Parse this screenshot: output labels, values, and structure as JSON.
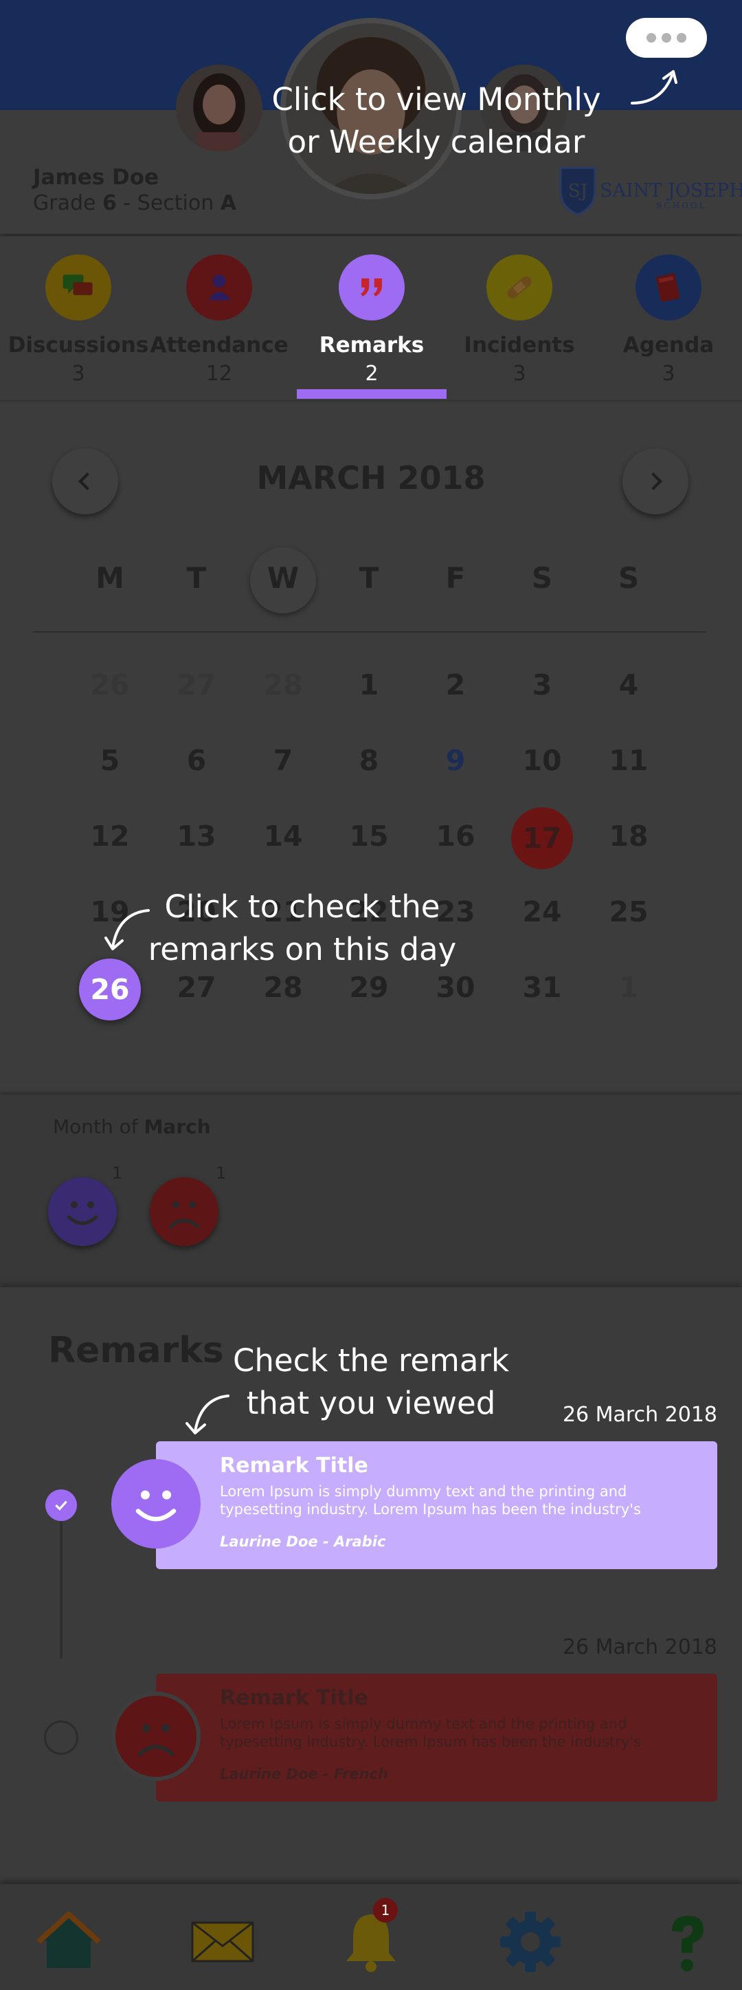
{
  "header": {
    "student_name": "James Doe",
    "grade_prefix": "Grade ",
    "grade_number": "6",
    "section_prefix": " - Section ",
    "section_letter": "A",
    "school_name": "SAINT JOSEPH",
    "school_sub": "SCHOOL",
    "school_monogram": "SJ"
  },
  "tabs": [
    {
      "label": "Discussions",
      "count": "3",
      "icon": "chat-bubbles-icon",
      "color": "#6b5608"
    },
    {
      "label": "Attendance",
      "count": "12",
      "icon": "person-icon",
      "color": "#5f1515"
    },
    {
      "label": "Remarks",
      "count": "2",
      "icon": "quote-icon",
      "color": "#9d6cf2",
      "active": true
    },
    {
      "label": "Incidents",
      "count": "3",
      "icon": "bandage-icon",
      "color": "#6b6108"
    },
    {
      "label": "Agenda",
      "count": "3",
      "icon": "book-icon",
      "color": "#182c59"
    }
  ],
  "calendar": {
    "title": "MARCH 2018",
    "weekdays": [
      "M",
      "T",
      "W",
      "T",
      "F",
      "S",
      "S"
    ],
    "weeks": [
      [
        "26",
        "27",
        "28",
        "1",
        "2",
        "3",
        "4"
      ],
      [
        "5",
        "6",
        "7",
        "8",
        "9",
        "10",
        "11"
      ],
      [
        "12",
        "13",
        "14",
        "15",
        "16",
        "17",
        "18"
      ],
      [
        "19",
        "20",
        "21",
        "22",
        "23",
        "24",
        "25"
      ],
      [
        "26",
        "27",
        "28",
        "29",
        "30",
        "31",
        "1"
      ]
    ],
    "muted_days": [
      "0-0",
      "0-1",
      "0-2",
      "4-6"
    ],
    "highlight_blue": "1-4",
    "marked_day": "17",
    "selected_day": "26"
  },
  "summary": {
    "label_prefix": "Month of ",
    "month": "March",
    "happy_count": "1",
    "sad_count": "1"
  },
  "remarks": {
    "title": "Remarks",
    "items": [
      {
        "date": "26 March 2018",
        "title": "Remark Title",
        "body": "Lorem Ipsum is simply dummy text and the printing and typesetting industry. Lorem Ipsum has been the industry's",
        "author": "Laurine Doe - Arabic",
        "mood": "happy",
        "viewed": true
      },
      {
        "date": "26 March 2018",
        "title": "Remark Title",
        "body": "Lorem Ipsum is simply dummy text and the printing and typesetting industry. Lorem Ipsum has been the industry's",
        "author": "Laurine Doe - French",
        "mood": "sad",
        "viewed": false
      }
    ]
  },
  "bottom_nav": {
    "items": [
      "home-icon",
      "mail-icon",
      "bell-icon",
      "gear-icon",
      "help-icon"
    ],
    "notification_count": "1"
  },
  "hints": {
    "calendar_toggle": [
      "Click to view Monthly",
      "or Weekly calendar"
    ],
    "day": [
      "Click to check the",
      "remarks on this day"
    ],
    "remark": [
      "Check the remark",
      "that you viewed"
    ]
  },
  "colors": {
    "accent": "#9d6cf2",
    "card_active": "#c6adfd",
    "card_dim": "#5f1d1d",
    "header": "#182c59",
    "red": "#7a1717"
  }
}
